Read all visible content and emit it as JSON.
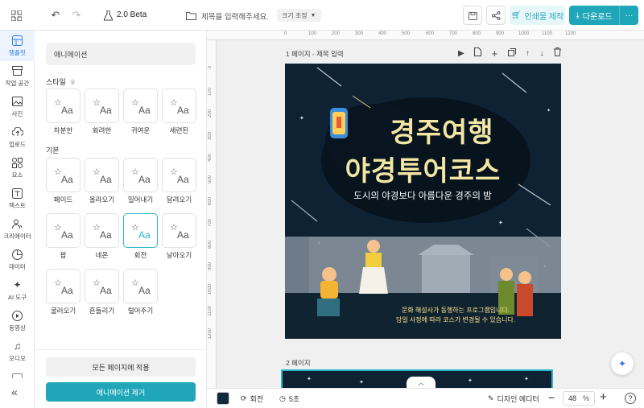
{
  "app": {
    "version": "2.0 Beta"
  },
  "header": {
    "title_placeholder": "제목을 입력해주세요.",
    "size_label": "크기 조정",
    "print_label": "인쇄물 제작",
    "download_label": "다운로드",
    "more_label": "···"
  },
  "rail": {
    "items": [
      {
        "label": "템플릿",
        "icon": "template-icon"
      },
      {
        "label": "작업 공간",
        "icon": "workspace-icon"
      },
      {
        "label": "사진",
        "icon": "photo-icon"
      },
      {
        "label": "업로드",
        "icon": "upload-icon"
      },
      {
        "label": "요소",
        "icon": "elements-icon"
      },
      {
        "label": "텍스트",
        "icon": "text-icon"
      },
      {
        "label": "크리에이터",
        "icon": "creator-icon"
      },
      {
        "label": "데이터",
        "icon": "data-icon"
      },
      {
        "label": "AI 도구",
        "icon": "ai-tools-icon"
      },
      {
        "label": "동영상",
        "icon": "video-icon"
      },
      {
        "label": "오디오",
        "icon": "audio-icon"
      }
    ],
    "collapse": "«"
  },
  "panel": {
    "search_value": "애니메이션",
    "style_section": "스타일",
    "basic_section": "기본",
    "style_items": [
      "차분한",
      "화려한",
      "귀여운",
      "세련된"
    ],
    "basic_items": [
      "페이드",
      "올라오기",
      "밀어내기",
      "달려오기",
      "팝",
      "네온",
      "회전",
      "날아오기",
      "굴러오기",
      "흔들리기",
      "털어주기"
    ],
    "card_glyph": "Aa",
    "apply_all": "모든 페이지에 적용",
    "remove": "애니메이션 제거"
  },
  "canvas": {
    "ruler_top": [
      "0",
      "100",
      "200",
      "300",
      "400",
      "500",
      "600",
      "700",
      "800",
      "900",
      "1000",
      "1100",
      "1200"
    ],
    "ruler_left": [
      "0",
      "100",
      "200",
      "300",
      "400",
      "500",
      "600",
      "700",
      "800",
      "900",
      "1000",
      "1100",
      "1200"
    ],
    "page1_label": "1 페이지 - 제목 입력",
    "page2_label": "2 페이지"
  },
  "poster": {
    "title_line1": "경주여행",
    "title_line2": "야경투어코스",
    "subtitle": "도시의 야경보다 아름다운 경주의 밤",
    "note_line1": "문화 해설사가 동행하는 프로그램입니다.",
    "note_line2": "당일 사정에 따라 코스가 변경될 수 있습니다.",
    "colors": {
      "bg": "#0f2233",
      "title": "#f3e6a4",
      "accent": "#2bb7c8"
    }
  },
  "bottom": {
    "color_swatch": "#102a3c",
    "rotate_label": "회전",
    "duration_label": "5초",
    "editor_label": "디자인 에디터",
    "zoom_value": "48",
    "zoom_unit": "%",
    "help": "?"
  }
}
